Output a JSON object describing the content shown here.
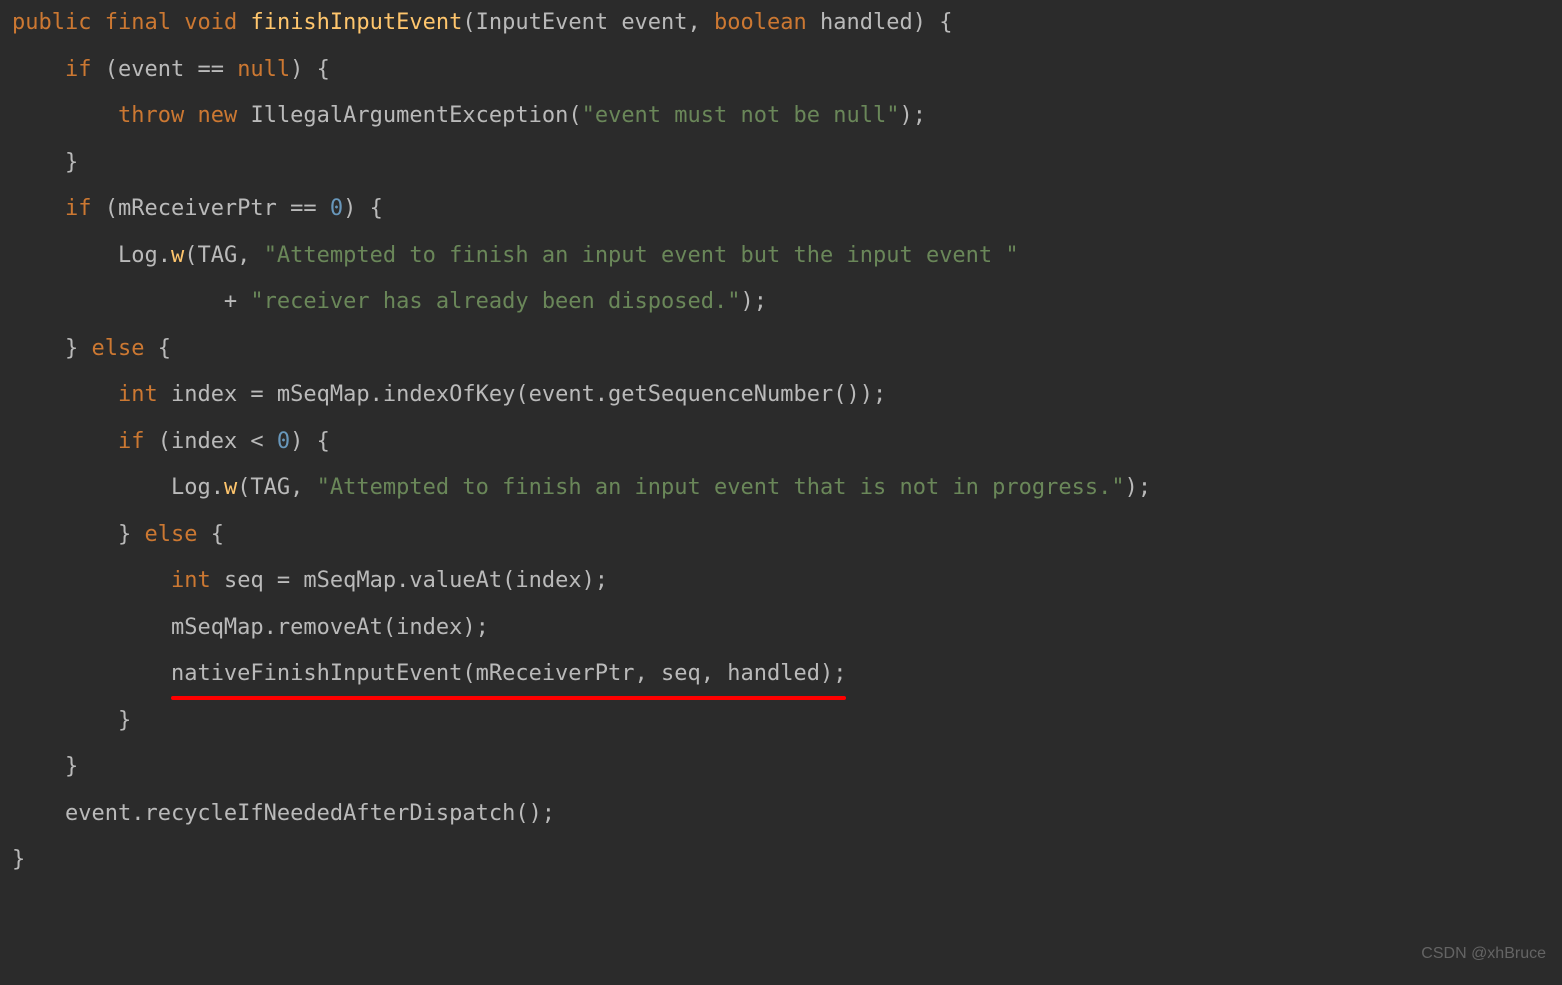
{
  "code": {
    "l1": {
      "kw1": "public",
      "kw2": "final",
      "kw3": "void",
      "fn": "finishInputEvent",
      "p": "(InputEvent event, ",
      "kw4": "boolean",
      "p2": " handled) {"
    },
    "l2": {
      "kw": "if",
      "t": " (event == ",
      "kw2": "null",
      "t2": ") {"
    },
    "l3": {
      "kw": "throw",
      "kw2": "new",
      "cls": " IllegalArgumentException(",
      "str": "\"event must not be null\"",
      "t2": ");"
    },
    "l4": {
      "t": "}"
    },
    "l5": {
      "kw": "if",
      "t": " (mReceiverPtr == ",
      "num": "0",
      "t2": ") {"
    },
    "l6": {
      "t": "Log.",
      "fn": "w",
      "t2": "(TAG, ",
      "str": "\"Attempted to finish an input event but the input event \""
    },
    "l7": {
      "t": "+ ",
      "str": "\"receiver has already been disposed.\"",
      "t2": ");"
    },
    "l8": {
      "t": "} ",
      "kw": "else",
      "t2": " {"
    },
    "l9": {
      "kw": "int",
      "t": " index = mSeqMap.indexOfKey(event.getSequenceNumber());"
    },
    "l10": {
      "kw": "if",
      "t": " (index < ",
      "num": "0",
      "t2": ") {"
    },
    "l11": {
      "t": "Log.",
      "fn": "w",
      "t2": "(TAG, ",
      "str": "\"Attempted to finish an input event that is not in progress.\"",
      "t3": ");"
    },
    "l12": {
      "t": "} ",
      "kw": "else",
      "t2": " {"
    },
    "l13": {
      "kw": "int",
      "t": " seq = mSeqMap.valueAt(index);"
    },
    "l14": {
      "t": "mSeqMap.removeAt(index);"
    },
    "l15": {
      "t": "nativeFinishInputEvent(mReceiverPtr, seq, handled);"
    },
    "l16": {
      "t": "}"
    },
    "l17": {
      "t": "}"
    },
    "l18": {
      "t": "event.recycleIfNeededAfterDispatch();"
    },
    "l19": {
      "t": "}"
    }
  },
  "watermark": "CSDN @xhBruce"
}
